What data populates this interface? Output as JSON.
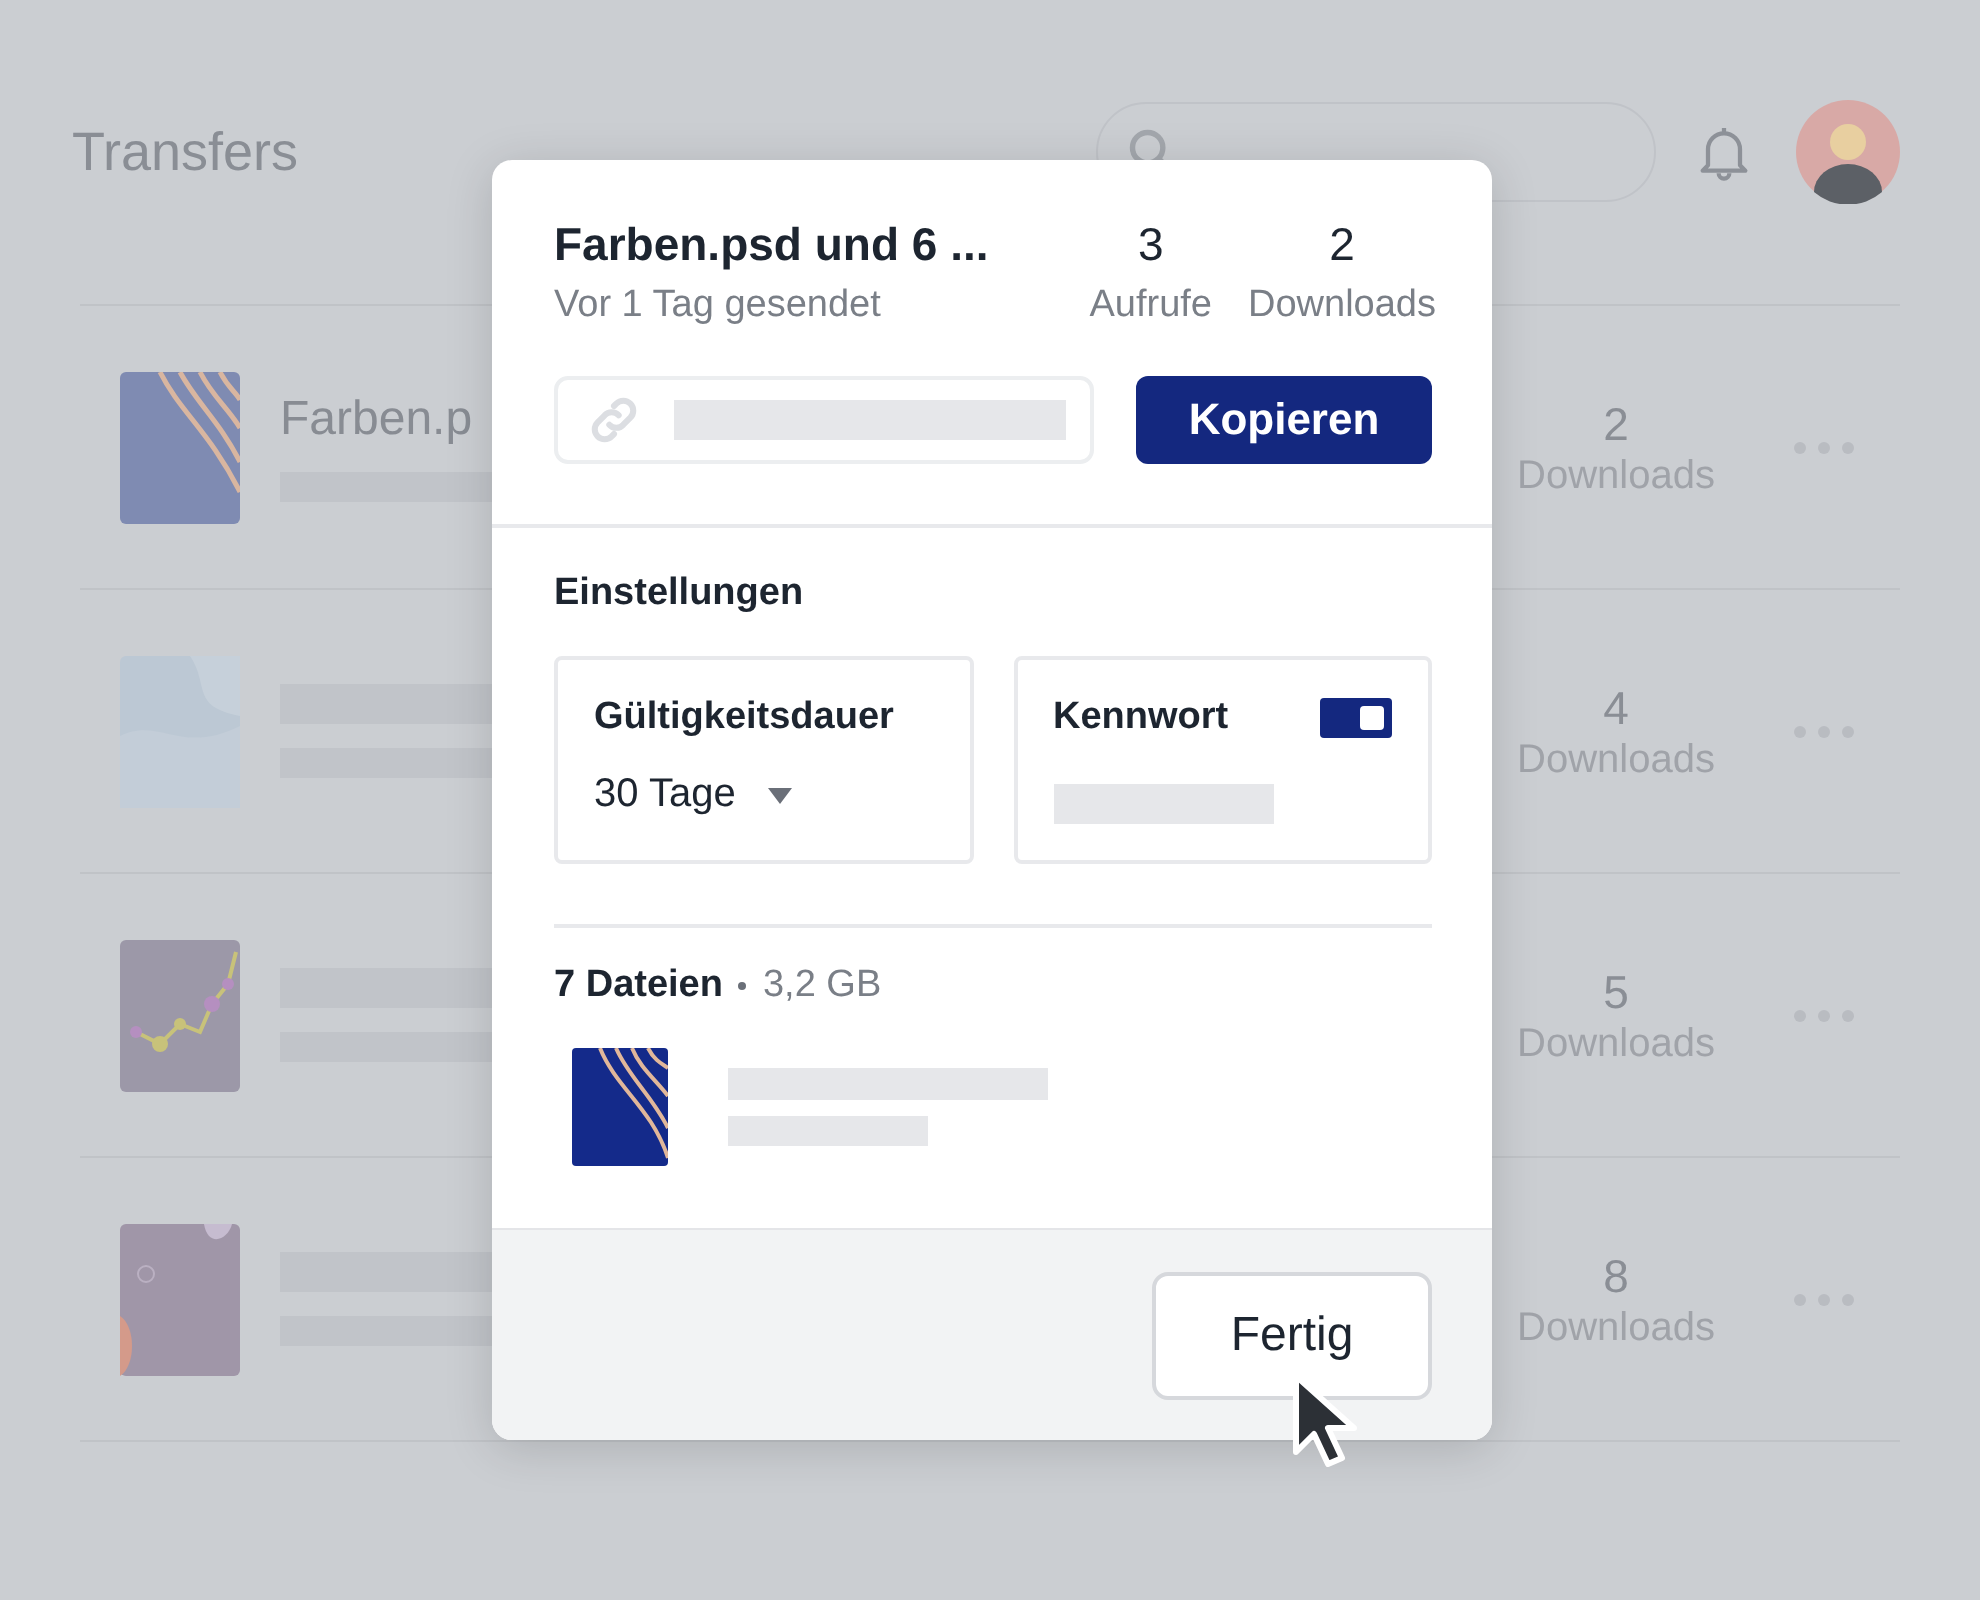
{
  "header": {
    "title": "Transfers"
  },
  "transfers": [
    {
      "name": "Farben.p",
      "count": "2",
      "count_label": "Downloads"
    },
    {
      "count": "4",
      "count_label": "Downloads"
    },
    {
      "count": "5",
      "count_label": "Downloads"
    },
    {
      "count": "8",
      "count_label": "Downloads"
    }
  ],
  "dialog": {
    "title": "Farben.psd und 6 ...",
    "subtitle": "Vor 1 Tag gesendet",
    "stats": [
      {
        "value": "3",
        "label": "Aufrufe"
      },
      {
        "value": "2",
        "label": "Downloads"
      }
    ],
    "copy_button": "Kopieren",
    "settings": {
      "title": "Einstellungen",
      "expiry": {
        "label": "Gültigkeitsdauer",
        "value": "30 Tage"
      },
      "password": {
        "label": "Kennwort",
        "on": true
      }
    },
    "files": {
      "count": "7 Dateien",
      "size": "3,2 GB"
    },
    "done_button": "Fertig"
  }
}
